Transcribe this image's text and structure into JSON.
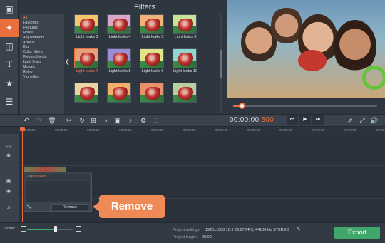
{
  "left_tools": [
    {
      "icon": "film-import-icon"
    },
    {
      "icon": "magic-wand-icon"
    },
    {
      "icon": "film-strip-icon"
    },
    {
      "icon": "text-icon"
    },
    {
      "icon": "star-icon"
    },
    {
      "icon": "list-icon"
    }
  ],
  "filters": {
    "title": "Filters",
    "categories": [
      "All",
      "Favorites",
      "Featured",
      "Noise",
      "Adjustments",
      "Artistic",
      "Blur",
      "Color filters",
      "Flying objects",
      "Light leaks",
      "Mosaic",
      "Retro",
      "Vignettes"
    ],
    "selected_category": "All",
    "tiles": [
      {
        "label": "Light leaks 3",
        "tint": "#f4c66b"
      },
      {
        "label": "Light leaks 4",
        "tint": "#d8a6c9"
      },
      {
        "label": "Light leaks 5",
        "tint": "#f0b37a"
      },
      {
        "label": "Light leaks 6",
        "tint": "#c9e39a"
      },
      {
        "label": "Light leaks 7",
        "tint": "#e6a17a"
      },
      {
        "label": "Light leaks 8",
        "tint": "#9a8ed8"
      },
      {
        "label": "Light leaks 9",
        "tint": "#e0e58a"
      },
      {
        "label": "Light leaks 10",
        "tint": "#8fd6d0"
      },
      {
        "label": "",
        "tint": "#e8d5a3"
      },
      {
        "label": "",
        "tint": "#f0b06a"
      },
      {
        "label": "",
        "tint": "#e8916a"
      },
      {
        "label": "",
        "tint": "#b9cfa0"
      }
    ],
    "selected_tile": "Light leaks 7"
  },
  "player": {
    "timecode_main": "00:00:00.",
    "timecode_ms": "500"
  },
  "ruler_ticks": [
    "00:00:00",
    "00:00:05",
    "00:00:10",
    "00:00:15",
    "00:00:20",
    "00:00:25",
    "00:00:30",
    "00:00:35",
    "00:00:40",
    "00:00:45",
    "00:00:50",
    "00:00:55"
  ],
  "popup": {
    "title": "Light leaks 7",
    "remove_label": "Remove"
  },
  "callout": {
    "text": "Remove"
  },
  "bottom": {
    "scale_label": "Scale:",
    "settings_label": "Project settings:",
    "settings_value": "1920x1080 16:9 29.97 FPS, 44100 Hz STEREO",
    "length_label": "Project length:",
    "length_value": "00:00",
    "export_label": "Export"
  },
  "colors": {
    "accent": "#e9703e",
    "export": "#3fa86a",
    "scale_fill": "#3fae6b"
  }
}
